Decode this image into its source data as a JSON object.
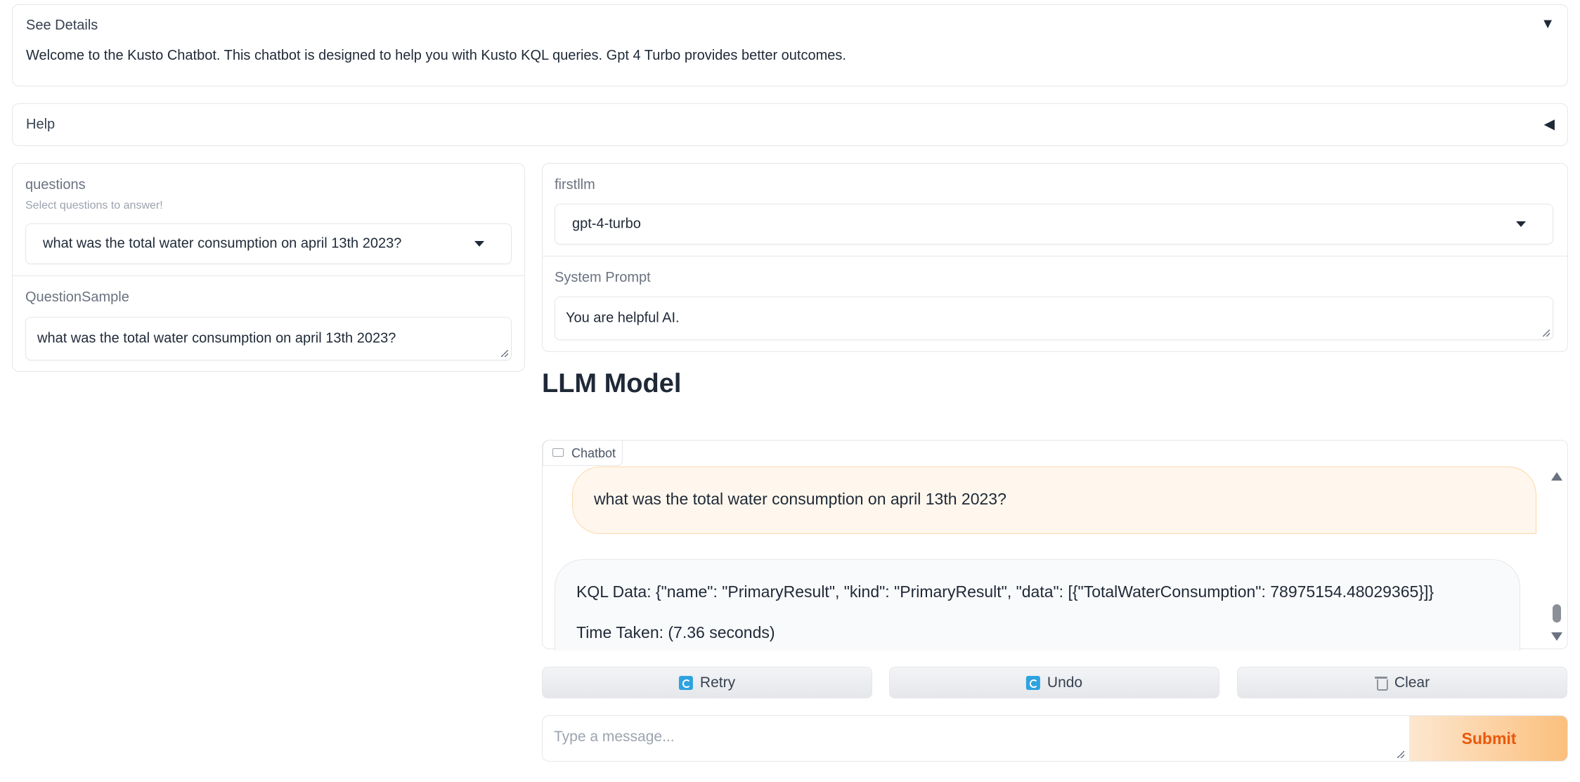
{
  "details": {
    "title": "See Details",
    "body": "Welcome to the Kusto Chatbot. This chatbot is designed to help you with Kusto KQL queries. Gpt 4 Turbo provides better outcomes.",
    "arrow": "▼"
  },
  "help": {
    "title": "Help",
    "arrow": "◀"
  },
  "left": {
    "questions_label": "questions",
    "questions_info": "Select questions to answer!",
    "questions_value": "what was the total water consumption on april 13th 2023?",
    "sample_label": "QuestionSample",
    "sample_value": "what was the total water consumption on april 13th 2023?"
  },
  "right": {
    "llm_label": "firstllm",
    "llm_value": "gpt-4-turbo",
    "system_label": "System Prompt",
    "system_value": "You are helpful AI."
  },
  "heading": "LLM Model",
  "chatbot": {
    "tab_label": "Chatbot",
    "user_message": "what was the total water consumption on april 13th 2023?",
    "bot_line1": "KQL Data: {\"name\": \"PrimaryResult\", \"kind\": \"PrimaryResult\", \"data\": [{\"TotalWaterConsumption\": 78975154.48029365}]}",
    "bot_line2": "Time Taken: (7.36 seconds)"
  },
  "buttons": {
    "retry": "Retry",
    "undo": "Undo",
    "clear": "Clear"
  },
  "input": {
    "placeholder": "Type a message...",
    "submit": "Submit"
  },
  "icons": [
    "chevron-down-icon",
    "chevron-left-icon",
    "dropdown-caret-icon",
    "chat-bubble-icon",
    "retry-icon",
    "undo-icon",
    "trash-icon"
  ],
  "colors": {
    "accent": "#ea580c",
    "user_bubble": "#fff7ed",
    "icon_blue": "#2ea3df"
  }
}
